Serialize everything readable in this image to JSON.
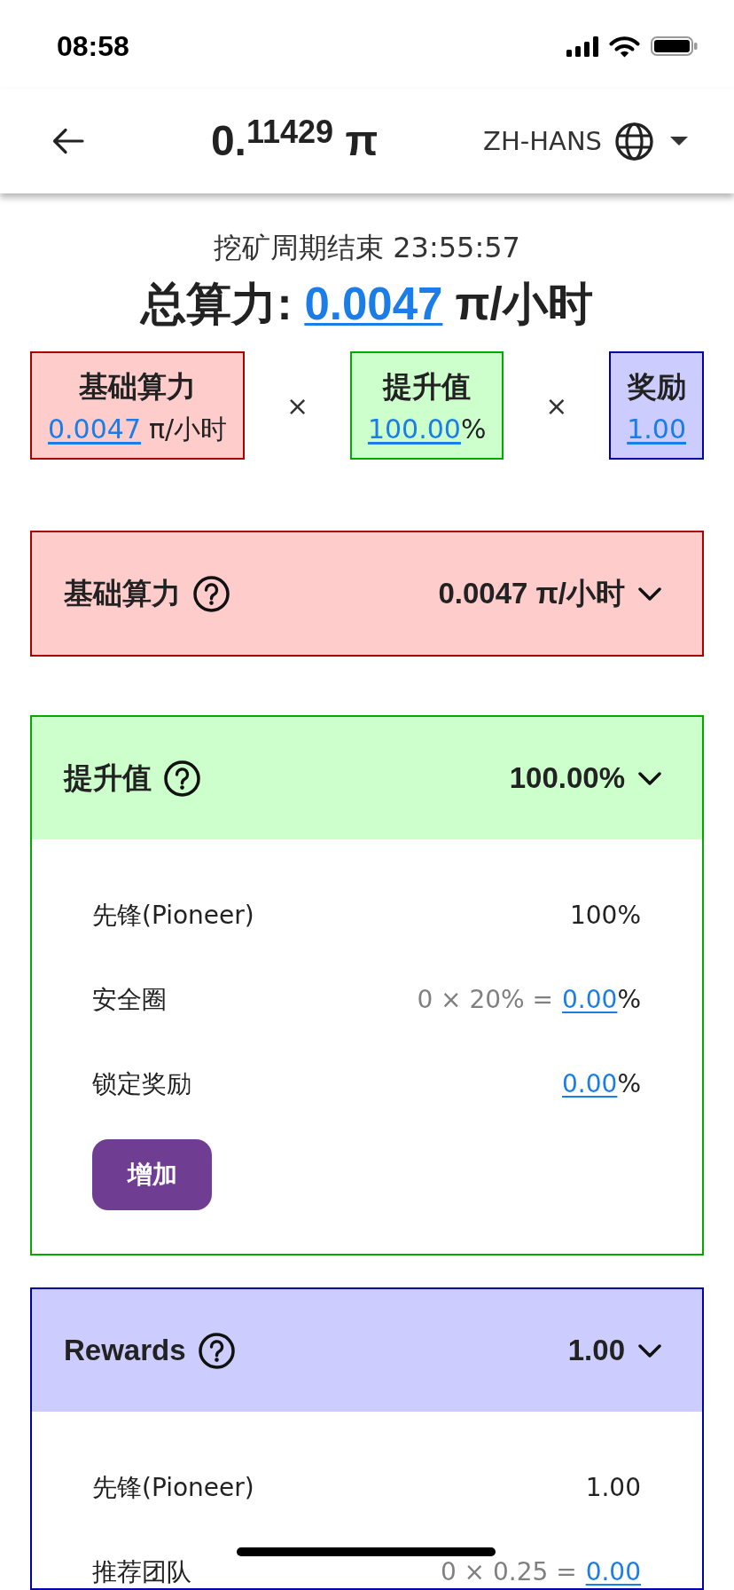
{
  "status_bar": {
    "time": "08:58"
  },
  "header": {
    "balance": "0.$^{11429}$ π",
    "language": "ZH-HANS"
  },
  "summary": {
    "countdown": "挖矿周期结束 23:55:57",
    "total_label": "总算力:",
    "total_value": "0.0047",
    "total_unit": "π/小时",
    "factors": [
      {
        "label": "基础算力",
        "value": "0.0047",
        "unit": "π/小时",
        "color": "#ffcccc"
      },
      {
        "label": "提升值",
        "value": "100.00",
        "suffix": "%",
        "color": "#ccffcc"
      },
      {
        "label": "奖励",
        "value": "1.00",
        "color": "#ccccff"
      }
    ],
    "operators": [
      "×",
      "×"
    ]
  },
  "panels": [
    {
      "title": "基础算力",
      "value": "0.0047 π/小时",
      "color": "#ffcccc",
      "expanded": false
    },
    {
      "title": "提升值",
      "value": "100.00%",
      "color": "#ccffcc",
      "expanded": true,
      "rows": [
        {
          "label": "先锋(Pioneer)",
          "amount": "100%",
          "link": false
        },
        {
          "label": "安全圈",
          "formula": "0 × 20% =",
          "amount": "0.00",
          "link": true,
          "suffix": "%"
        },
        {
          "label": "锁定奖励",
          "amount": "0.00",
          "link": true,
          "suffix": "%"
        }
      ],
      "button": "增加"
    },
    {
      "title": "Rewards",
      "value": "1.00",
      "color": "#ccccff",
      "expanded": true,
      "rows": [
        {
          "label": "先锋(Pioneer)",
          "amount": "1.00",
          "link": false
        },
        {
          "label": "推荐团队",
          "formula": "0 × 0.25 =",
          "amount": "0.00",
          "link": true
        }
      ]
    }
  ]
}
